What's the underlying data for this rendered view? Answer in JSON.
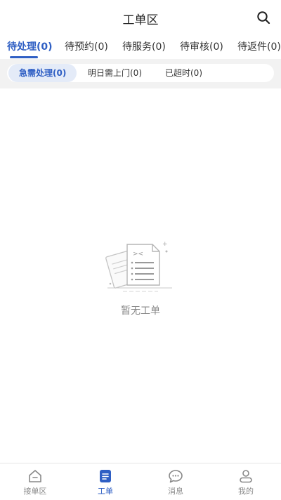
{
  "header": {
    "title": "工单区"
  },
  "tabs": [
    {
      "label": "待处理(0)"
    },
    {
      "label": "待预约(0)"
    },
    {
      "label": "待服务(0)"
    },
    {
      "label": "待审核(0)"
    },
    {
      "label": "待返件(0)"
    }
  ],
  "filters": [
    {
      "label": "急需处理(0)"
    },
    {
      "label": "明日需上门(0)"
    },
    {
      "label": "已超时(0)"
    }
  ],
  "empty_state": {
    "text": "暂无工单"
  },
  "bottom_nav": [
    {
      "label": "接单区",
      "icon": "home-icon"
    },
    {
      "label": "工单",
      "icon": "document-icon"
    },
    {
      "label": "消息",
      "icon": "chat-icon"
    },
    {
      "label": "我的",
      "icon": "user-icon"
    }
  ],
  "colors": {
    "accent": "#2f5fc4",
    "inactive": "#888888",
    "filter_bg": "#f2f2f2",
    "active_chip_bg": "#e4ebf8"
  }
}
